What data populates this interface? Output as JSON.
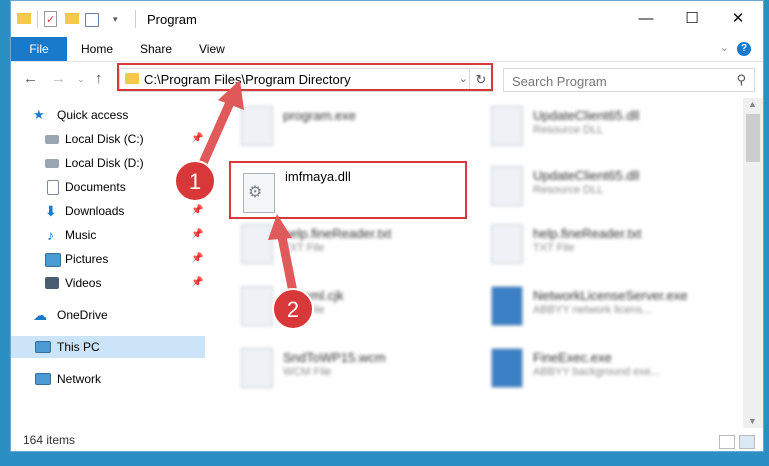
{
  "window": {
    "title": "Program"
  },
  "ribbon": {
    "tabs": [
      "File",
      "Home",
      "Share",
      "View"
    ]
  },
  "address": {
    "path": "C:\\Program Files\\Program Directory"
  },
  "search": {
    "placeholder": "Search Program"
  },
  "sidebar": {
    "items": [
      {
        "label": "Quick access",
        "icon": "star-icon",
        "pinned": false
      },
      {
        "label": "Local Disk (C:)",
        "icon": "drive-icon",
        "pinned": true
      },
      {
        "label": "Local Disk (D:)",
        "icon": "drive-icon",
        "pinned": false
      },
      {
        "label": "Documents",
        "icon": "documents-icon",
        "pinned": true
      },
      {
        "label": "Downloads",
        "icon": "download-icon",
        "pinned": true
      },
      {
        "label": "Music",
        "icon": "music-icon",
        "pinned": true
      },
      {
        "label": "Pictures",
        "icon": "pictures-icon",
        "pinned": true
      },
      {
        "label": "Videos",
        "icon": "videos-icon",
        "pinned": true
      },
      {
        "label": "OneDrive",
        "icon": "cloud-icon",
        "pinned": false
      },
      {
        "label": "This PC",
        "icon": "computer-icon",
        "pinned": false,
        "selected": true
      },
      {
        "label": "Network",
        "icon": "network-icon",
        "pinned": false
      }
    ]
  },
  "files": {
    "left": [
      {
        "name": "program.exe",
        "type": ""
      },
      {
        "name": "imfmaya.dll",
        "type": ""
      },
      {
        "name": "help.fineReader.txt",
        "type": "TXT File"
      },
      {
        "name": "ksTxml.cjk",
        "type": "CJK File"
      },
      {
        "name": "SndToWP15.wcm",
        "type": "WCM File"
      }
    ],
    "right": [
      {
        "name": "UpdateClient65.dll",
        "type": "Resource DLL"
      },
      {
        "name": "UpdateClient65.dll",
        "type": "Resource DLL"
      },
      {
        "name": "help.fineReader.txt",
        "type": "TXT File"
      },
      {
        "name": "NetworkLicenseServer.exe",
        "type": "ABBYY network licens..."
      },
      {
        "name": "FineExec.exe",
        "type": "ABBYY background exe..."
      }
    ]
  },
  "status": {
    "count": "164 items"
  },
  "annotations": {
    "badge1": "1",
    "badge2": "2",
    "accent": "#d9383a"
  }
}
